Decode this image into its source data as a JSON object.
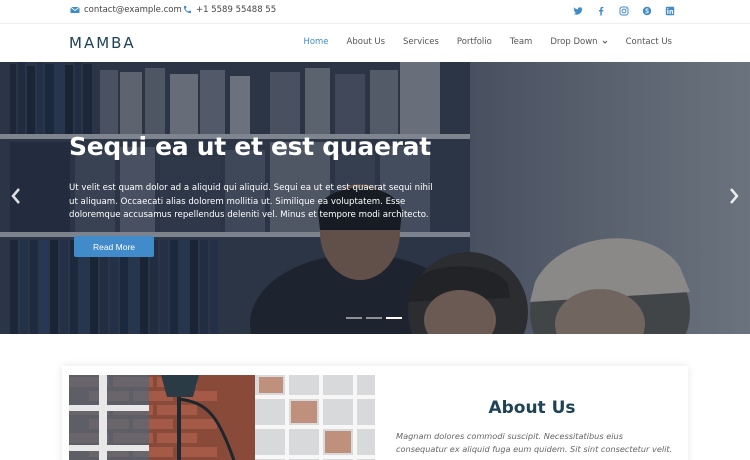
{
  "topbar": {
    "email": "contact@example.com",
    "phone": "+1 5589 55488 55",
    "socials": [
      "twitter-icon",
      "facebook-icon",
      "instagram-icon",
      "skype-icon",
      "linkedin-icon"
    ]
  },
  "header": {
    "logo": "MAMBA",
    "nav": [
      {
        "label": "Home",
        "active": true
      },
      {
        "label": "About Us"
      },
      {
        "label": "Services"
      },
      {
        "label": "Portfolio"
      },
      {
        "label": "Team"
      },
      {
        "label": "Drop Down",
        "dropdown": true
      },
      {
        "label": "Contact Us"
      }
    ]
  },
  "hero": {
    "title": "Sequi ea ut et est quaerat",
    "text": "Ut velit est quam dolor ad a aliquid qui aliquid. Sequi ea ut et est quaerat sequi nihil ut aliquam. Occaecati alias dolorem mollitia ut. Similique ea voluptatem. Esse doloremque accusamus repellendus deleniti vel. Minus et tempore modi architecto.",
    "button": "Read More",
    "slides": 3,
    "active_slide": 3
  },
  "about": {
    "title": "About Us",
    "text": "Magnam dolores commodi suscipit. Necessitatibus eius consequatur ex aliquid fuga eum quidem. Sit sint consectetur velit."
  },
  "colors": {
    "accent": "#428bca",
    "logo": "#1e4356"
  }
}
